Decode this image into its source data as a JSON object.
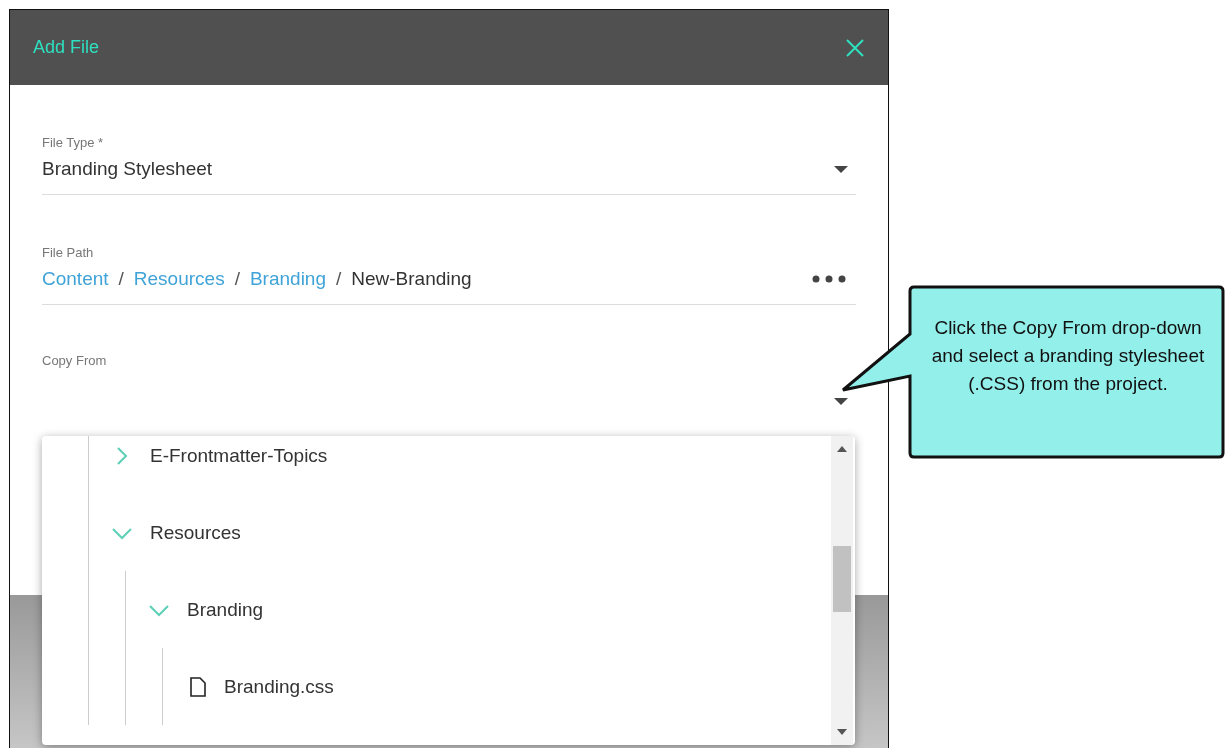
{
  "dialog": {
    "title": "Add File"
  },
  "file_type": {
    "label": "File Type *",
    "value": "Branding Stylesheet"
  },
  "file_path": {
    "label": "File Path",
    "segments": [
      {
        "text": "Content",
        "kind": "link"
      },
      {
        "text": "/",
        "kind": "separator"
      },
      {
        "text": "Resources",
        "kind": "link"
      },
      {
        "text": "/",
        "kind": "separator"
      },
      {
        "text": "Branding",
        "kind": "link"
      },
      {
        "text": "/",
        "kind": "separator"
      },
      {
        "text": "New-Branding",
        "kind": "name"
      }
    ]
  },
  "copy_from": {
    "label": "Copy From"
  },
  "tree": [
    {
      "label": "E-Frontmatter-Topics",
      "kind": "folder",
      "expanded": false
    },
    {
      "label": "Resources",
      "kind": "folder",
      "expanded": true,
      "children": [
        {
          "label": "Branding",
          "kind": "folder",
          "expanded": true,
          "children": [
            {
              "label": "Branding.css",
              "kind": "file"
            }
          ]
        }
      ]
    }
  ],
  "callout": {
    "text": "Click the Copy From drop-down and select a branding stylesheet (.CSS) from the project."
  }
}
